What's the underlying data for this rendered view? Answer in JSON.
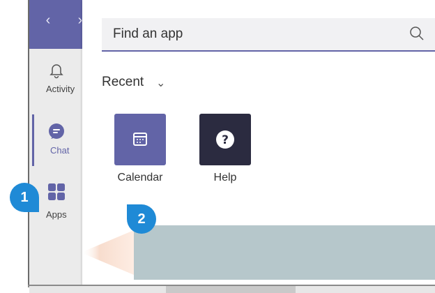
{
  "nav": {
    "back_label": "‹",
    "forward_label": "›"
  },
  "rail": {
    "items": [
      {
        "label": "Activity",
        "icon": "bell-icon"
      },
      {
        "label": "Chat",
        "icon": "chat-icon"
      },
      {
        "label": "Apps",
        "icon": "apps-icon"
      }
    ],
    "active": "Chat"
  },
  "search": {
    "placeholder": "Find an app",
    "icon": "search-icon"
  },
  "recent": {
    "label": "Recent",
    "chevron": "⌄"
  },
  "apps": [
    {
      "label": "Calendar",
      "icon": "calendar-icon"
    },
    {
      "label": "Help",
      "icon": "help-icon"
    }
  ],
  "callouts": [
    {
      "number": "1"
    },
    {
      "number": "2"
    }
  ],
  "colors": {
    "accent": "#6264a7",
    "callout": "#1f8ad6",
    "overlay": "#b6c7cb"
  }
}
